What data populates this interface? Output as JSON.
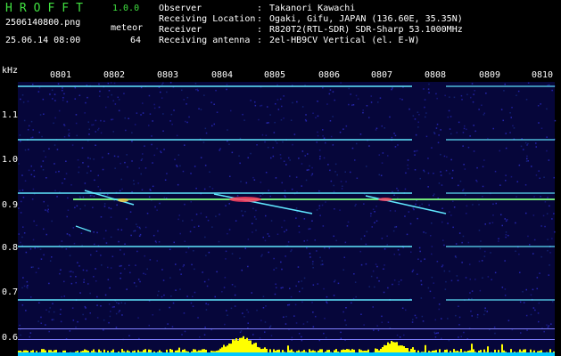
{
  "header": {
    "app_title": "HROFFT",
    "version": "1.0.0",
    "filename": "2506140800.png",
    "timestamp": "25.06.14 08:00",
    "meteor_label": "meteor",
    "meteor_count": "64"
  },
  "info": [
    {
      "key": "Observer",
      "value": "Takanori Kawachi"
    },
    {
      "key": "Receiving Location",
      "value": "Ogaki, Gifu, JAPAN (136.60E, 35.35N)"
    },
    {
      "key": "Receiver",
      "value": "R820T2(RTL-SDR) SDR-Sharp 53.1000MHz"
    },
    {
      "key": "Receiving antenna",
      "value": "2el-HB9CV Vertical (el. E-W)"
    }
  ],
  "axis": {
    "freq_unit": "kHz",
    "time_labels": [
      "0801",
      "0802",
      "0803",
      "0804",
      "0805",
      "0806",
      "0807",
      "0808",
      "0809",
      "0810"
    ],
    "freq_labels": [
      "1.1",
      "1.0",
      "0.9",
      "0.8",
      "0.7",
      "0.6"
    ]
  },
  "colors": {
    "background": "#06063a",
    "header_green": "#40e040",
    "signal_cyan": "#60e8ff",
    "carrier_green": "#80ff80",
    "meteor_red": "#ff4060",
    "meter_yellow": "#ffff00",
    "meter_cyan": "#00c8ff"
  }
}
